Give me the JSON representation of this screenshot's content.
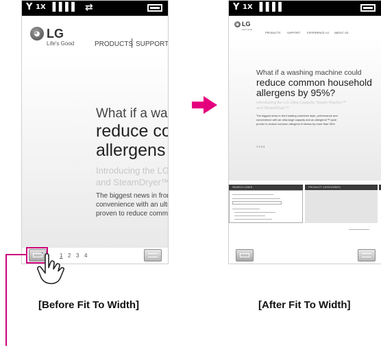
{
  "status_bar": {
    "signal_icon": "signal-antenna-icon",
    "network_label": "1X",
    "sync_label": "⇄",
    "battery_icon": "battery-icon"
  },
  "site": {
    "logo_text": "LG",
    "tagline": "Life's Good",
    "nav_products": "PRODUCTS",
    "nav_support": "SUPPORT",
    "nav_experience": "EXPERIENCE LG",
    "nav_about": "ABOUT US"
  },
  "before": {
    "headline_1": "What if a was",
    "headline_2": "reduce co",
    "headline_3": "allergens by",
    "intro_1": "Introducing the LG",
    "intro_2": "and SteamDryer™.",
    "body_1": "The biggest news in front",
    "body_2": "convenience with an ultra-",
    "body_3": "proven to reduce commo",
    "pages": [
      "1",
      "2",
      "3",
      "4"
    ]
  },
  "after": {
    "headline_1": "What if a washing machine could",
    "headline_2": "reduce common household",
    "headline_3": "allergens by 95%?",
    "intro_1": "Introducing the LG Ultra Capacity Steam Washer™",
    "intro_2": "and SteamDryer™.",
    "body_1": "The biggest news in front loading combines style, performance and",
    "body_2": "convenience with an ultra-large capacity and an allergiene™ cycle",
    "body_3": "proven to reduce common allergens in fabrics by more than 95%.",
    "pages": "1 2 3 4",
    "left_tab": "SEARCH LINKS",
    "middle_tab": "PRODUCT CATEGORIES"
  },
  "captions": {
    "before": "[Before Fit To Width]",
    "after": "[After Fit To Width]"
  },
  "colors": {
    "accent": "#e5007e",
    "callout": "#cc007a"
  }
}
